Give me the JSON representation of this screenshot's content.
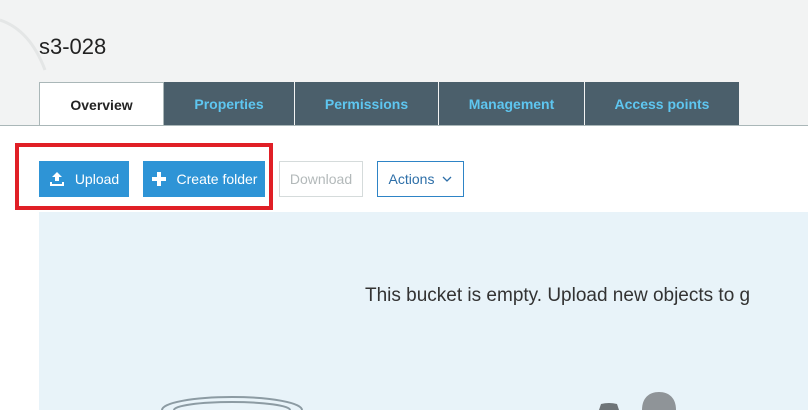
{
  "bucket": {
    "name": "s3-028"
  },
  "tabs": [
    {
      "label": "Overview",
      "active": true
    },
    {
      "label": "Properties",
      "active": false
    },
    {
      "label": "Permissions",
      "active": false
    },
    {
      "label": "Management",
      "active": false
    },
    {
      "label": "Access points",
      "active": false
    }
  ],
  "toolbar": {
    "upload_label": "Upload",
    "upload_icon": "upload-icon",
    "create_folder_label": "Create folder",
    "create_folder_icon": "plus-icon",
    "download_label": "Download",
    "download_disabled": true,
    "actions_label": "Actions",
    "actions_icon": "chevron-down-icon"
  },
  "empty_state": {
    "message": "This bucket is empty. Upload new objects to g"
  },
  "colors": {
    "primary_button": "#2e94d6",
    "tab_background": "#4b5f6b",
    "tab_text": "#5ec6f0",
    "highlight_border": "#e01f26",
    "empty_background": "#e8f3f9"
  }
}
